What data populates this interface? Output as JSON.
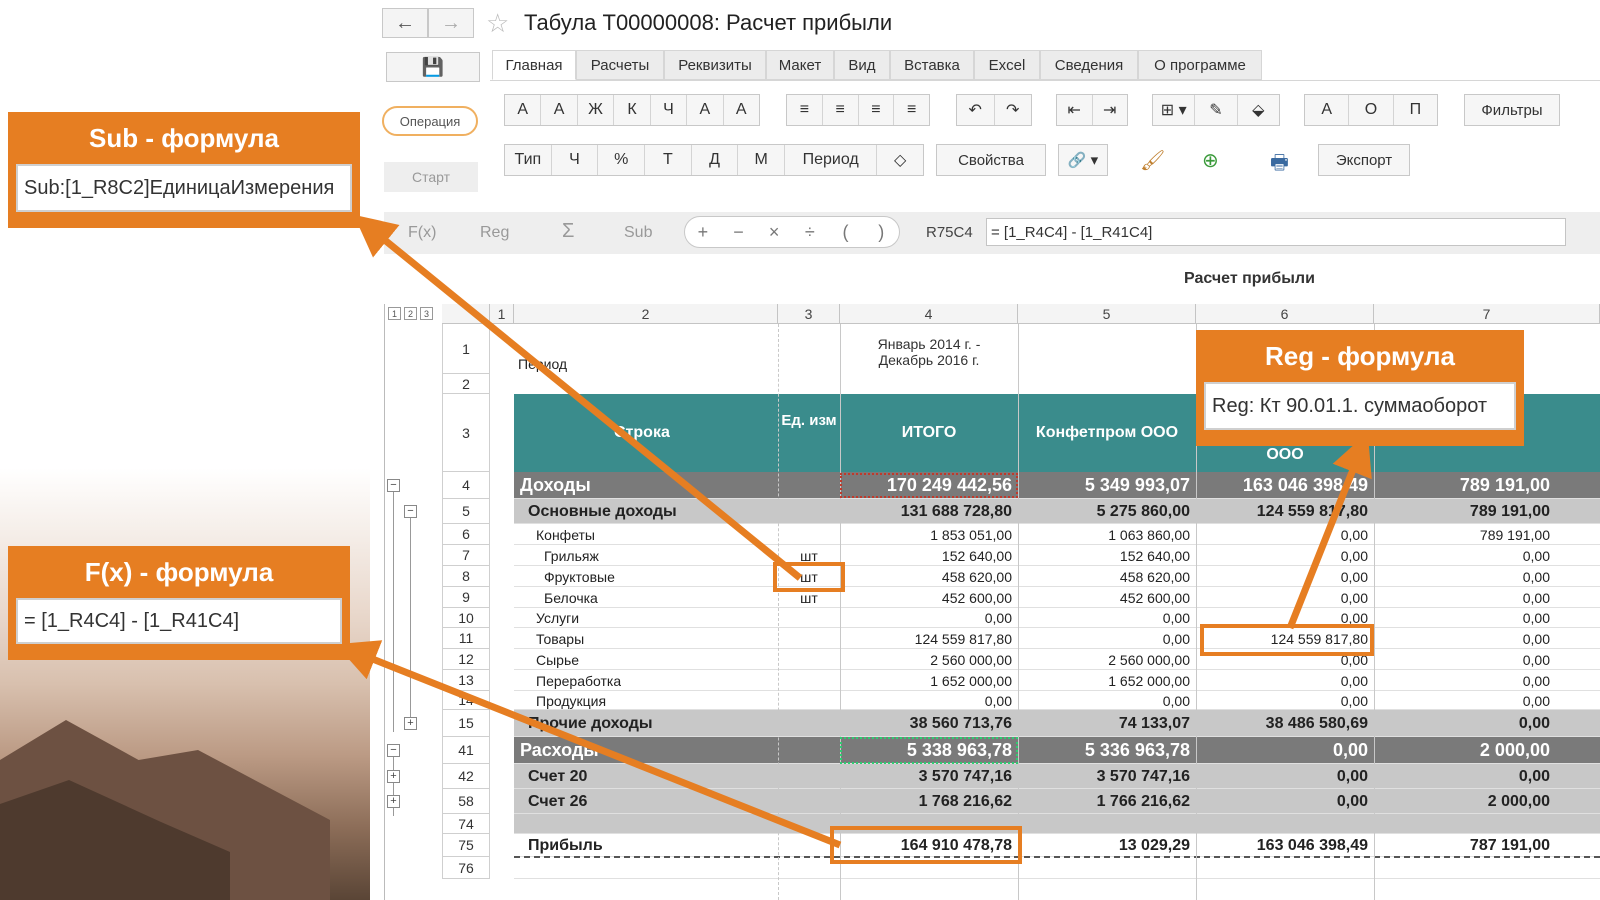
{
  "window": {
    "title": "Табула Т00000008: Расчет прибыли",
    "back_icon": "←",
    "forward_icon": "→",
    "star_icon": "☆"
  },
  "left_panel": {
    "save_icon": "💾",
    "operation_label": "Операция",
    "start_label": "Старт"
  },
  "tabs": [
    "Главная",
    "Расчеты",
    "Реквизиты",
    "Макет",
    "Вид",
    "Вставка",
    "Excel",
    "Сведения",
    "О программе"
  ],
  "format_buttons": [
    "A",
    "A",
    "Ж",
    "К",
    "Ч",
    "A",
    "A"
  ],
  "align_buttons": [
    "≡",
    "≡",
    "≡",
    "≡"
  ],
  "undo_buttons": [
    "↶",
    "↷"
  ],
  "indent_buttons": [
    "⇤",
    "⇥"
  ],
  "insert_buttons": [
    "⊞ ▾",
    "✎",
    "⬙"
  ],
  "aop_buttons": [
    "А",
    "О",
    "П"
  ],
  "filters_label": "Фильтры",
  "type_buttons": [
    "Тип",
    "Ч",
    "%",
    "Т",
    "Д",
    "М",
    "Период",
    "◇"
  ],
  "properties_label": "Свойства",
  "link_icon": "🔗 ▾",
  "brush_icon": "🖌",
  "add_icon": "⊕",
  "print_icon": "🖶",
  "export_label": "Экспорт",
  "formula_bar": {
    "fx": "F(x)",
    "reg": "Reg",
    "sigma": "Σ",
    "sub": "Sub",
    "ops": [
      "+",
      "−",
      "×",
      "÷",
      "(",
      ")"
    ],
    "cell_ref": "R75C4",
    "formula": "= [1_R4C4] - [1_R41C4]"
  },
  "report_title": "Расчет прибыли",
  "levels": [
    "1",
    "2",
    "3"
  ],
  "columns": [
    "1",
    "2",
    "3",
    "4",
    "5",
    "6",
    "7"
  ],
  "period": {
    "row": "1",
    "label": "Период",
    "value_line1": "Январь 2014 г. -",
    "value_line2": "Декабрь 2016 г."
  },
  "header": {
    "row2": "2",
    "row3": "3",
    "stroka": "Строка",
    "unit": "Ед. изм",
    "itogo": "ИТОГО",
    "c5": "Конфетпром ООО",
    "c6": "ООО"
  },
  "rows": [
    {
      "n": "4",
      "label": "Доходы",
      "unit": "",
      "v4": "170 249 442,56",
      "v5": "5 349 993,07",
      "v6": "163 046 398,49",
      "v7": "789 191,00",
      "tree": "−",
      "indent": 0
    },
    {
      "n": "5",
      "label": "Основные доходы",
      "unit": "",
      "v4": "131 688 728,80",
      "v5": "5 275 860,00",
      "v6": "124 559 817,80",
      "v7": "789 191,00",
      "tree": "−",
      "indent": 1
    },
    {
      "n": "6",
      "label": "Конфеты",
      "unit": "",
      "v4": "1 853 051,00",
      "v5": "1 063 860,00",
      "v6": "0,00",
      "v7": "789 191,00",
      "tree": "",
      "indent": 2
    },
    {
      "n": "7",
      "label": "Грильяж",
      "unit": "шт",
      "v4": "152 640,00",
      "v5": "152 640,00",
      "v6": "0,00",
      "v7": "0,00",
      "tree": "",
      "indent": 3
    },
    {
      "n": "8",
      "label": "Фруктовые",
      "unit": "шт",
      "v4": "458 620,00",
      "v5": "458 620,00",
      "v6": "0,00",
      "v7": "0,00",
      "tree": "",
      "indent": 3
    },
    {
      "n": "9",
      "label": "Белочка",
      "unit": "шт",
      "v4": "452 600,00",
      "v5": "452 600,00",
      "v6": "0,00",
      "v7": "0,00",
      "tree": "",
      "indent": 3
    },
    {
      "n": "10",
      "label": "Услуги",
      "unit": "",
      "v4": "0,00",
      "v5": "0,00",
      "v6": "0,00",
      "v7": "0,00",
      "tree": "",
      "indent": 2
    },
    {
      "n": "11",
      "label": "Товары",
      "unit": "",
      "v4": "124 559 817,80",
      "v5": "0,00",
      "v6": "124 559 817,80",
      "v7": "0,00",
      "tree": "",
      "indent": 2
    },
    {
      "n": "12",
      "label": "Сырье",
      "unit": "",
      "v4": "2 560 000,00",
      "v5": "2 560 000,00",
      "v6": "0,00",
      "v7": "0,00",
      "tree": "",
      "indent": 2
    },
    {
      "n": "13",
      "label": "Переработка",
      "unit": "",
      "v4": "1 652 000,00",
      "v5": "1 652 000,00",
      "v6": "0,00",
      "v7": "0,00",
      "tree": "",
      "indent": 2
    },
    {
      "n": "14",
      "label": "Продукция",
      "unit": "",
      "v4": "0,00",
      "v5": "0,00",
      "v6": "0,00",
      "v7": "0,00",
      "tree": "",
      "indent": 2
    },
    {
      "n": "15",
      "label": "Прочие доходы",
      "unit": "",
      "v4": "38 560 713,76",
      "v5": "74 133,07",
      "v6": "38 486 580,69",
      "v7": "0,00",
      "tree": "+",
      "indent": 1
    },
    {
      "n": "41",
      "label": "Расходы",
      "unit": "",
      "v4": "5 338 963,78",
      "v5": "5 336 963,78",
      "v6": "0,00",
      "v7": "2 000,00",
      "tree": "−",
      "indent": 0
    },
    {
      "n": "42",
      "label": "Счет 20",
      "unit": "",
      "v4": "3 570 747,16",
      "v5": "3 570 747,16",
      "v6": "0,00",
      "v7": "0,00",
      "tree": "+",
      "indent": 1
    },
    {
      "n": "58",
      "label": "Счет 26",
      "unit": "",
      "v4": "1 768 216,62",
      "v5": "1 766 216,62",
      "v6": "0,00",
      "v7": "2 000,00",
      "tree": "+",
      "indent": 1
    },
    {
      "n": "74",
      "label": "",
      "unit": "",
      "v4": "",
      "v5": "",
      "v6": "",
      "v7": "",
      "tree": "",
      "indent": 0
    },
    {
      "n": "75",
      "label": "Прибыль",
      "unit": "",
      "v4": "164 910 478,78",
      "v5": "13 029,29",
      "v6": "163 046 398,49",
      "v7": "787 191,00",
      "tree": "",
      "indent": 1
    },
    {
      "n": "76",
      "label": "",
      "unit": "",
      "v4": "",
      "v5": "",
      "v6": "",
      "v7": "",
      "tree": "",
      "indent": 0
    }
  ],
  "callouts": {
    "sub": {
      "title": "Sub - формула",
      "value": "Sub:[1_R8C2]ЕдиницаИзмерения"
    },
    "fx": {
      "title": "F(x) - формула",
      "value": "= [1_R4C4] - [1_R41C4]"
    },
    "reg": {
      "title": "Reg - формула",
      "value": "Reg: Кт 90.01.1. суммаоборот"
    }
  },
  "colors": {
    "accent": "#e67e22",
    "teal": "#3a8c8c",
    "group_dark": "#7a7a7a",
    "group_mid": "#c8c8c8"
  }
}
